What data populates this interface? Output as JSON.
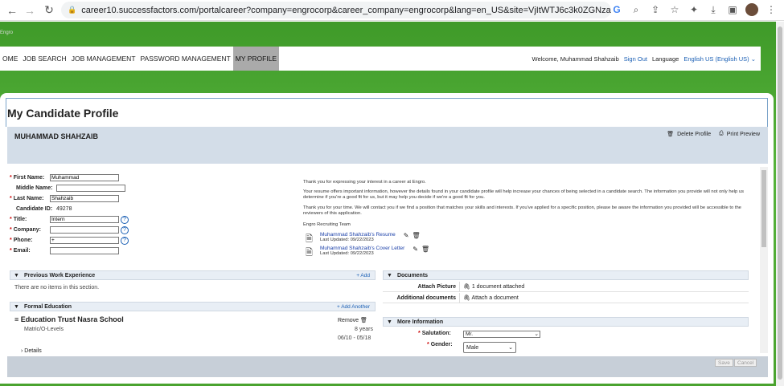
{
  "browser": {
    "url": "career10.successfactors.com/portalcareer?company=engrocorp&career_company=engrocorp&lang=en_US&site=VjItWTJ6c3k0ZGNzaXNIWIRrcUV..."
  },
  "logo": {
    "text": "Engro"
  },
  "nav": {
    "items": [
      "OME",
      "JOB SEARCH",
      "JOB MANAGEMENT",
      "PASSWORD MANAGEMENT",
      "MY PROFILE"
    ],
    "welcome": "Welcome,  Muhammad Shahzaib",
    "sign_out": "Sign Out",
    "language_label": "Language",
    "language_value": "English US (English US)"
  },
  "page": {
    "title": "My Candidate Profile",
    "candidate_name": "MUHAMMAD SHAHZAIB",
    "delete_profile": "Delete Profile",
    "print_preview": "Print Preview"
  },
  "form": {
    "first_name_label": "First Name:",
    "first_name": "Muhammad",
    "middle_name_label": "Middle Name:",
    "middle_name": "",
    "last_name_label": "Last Name:",
    "last_name": "Shahzaib",
    "candidate_id_label": "Candidate ID:",
    "candidate_id": "49278",
    "title_label": "Title:",
    "title": "Intern",
    "company_label": "Company:",
    "company": "",
    "phone_label": "Phone:",
    "phone": "+",
    "email_label": "Email:",
    "email": "",
    "help": "?"
  },
  "intro": {
    "p1": "Thank you for expressing your interest in a career at Engro.",
    "p2": "Your resume offers important information, however the details found in your candidate profile will help increase your chances of being selected in a candidate search. The information you provide will not only help us determine if you're a good fit for us, but it may help you decide if we're a good fit for you.",
    "p3": "Thank you for your time. We will contact you if we find a position that matches your skills and interests. If you've applied for a specific position, please be aware the information you provided will be accessible to the reviewers of this application.",
    "p4": "Engro Recruiting Team"
  },
  "attachments": [
    {
      "title": "Muhammad Shahzaib's Resume",
      "updated": "Last Updated: 09/22/2023"
    },
    {
      "title": "Muhammad Shahzaib's Cover Letter",
      "updated": "Last Updated: 09/22/2023"
    }
  ],
  "work_experience": {
    "heading": "Previous Work Experience",
    "add": "+ Add",
    "empty": "There are no items in this section."
  },
  "education": {
    "heading": "Formal Education",
    "add": "+ Add Another",
    "school": "Education Trust Nasra School",
    "remove": "Remove",
    "level": "Matric/O-Levels",
    "years": "8 years",
    "dates": "06/10 - 05/18",
    "details": "Details"
  },
  "documents": {
    "heading": "Documents",
    "picture_label": "Attach Picture",
    "picture_value": "1 document attached",
    "additional_label": "Additional documents",
    "additional_value": "Attach a document"
  },
  "more_info": {
    "heading": "More Information",
    "salutation_label": "Salutation:",
    "salutation_value": "Mr.",
    "gender_label": "Gender:",
    "gender_value": "Male"
  },
  "footer": {
    "save": "Save",
    "cancel": "Cancel"
  }
}
